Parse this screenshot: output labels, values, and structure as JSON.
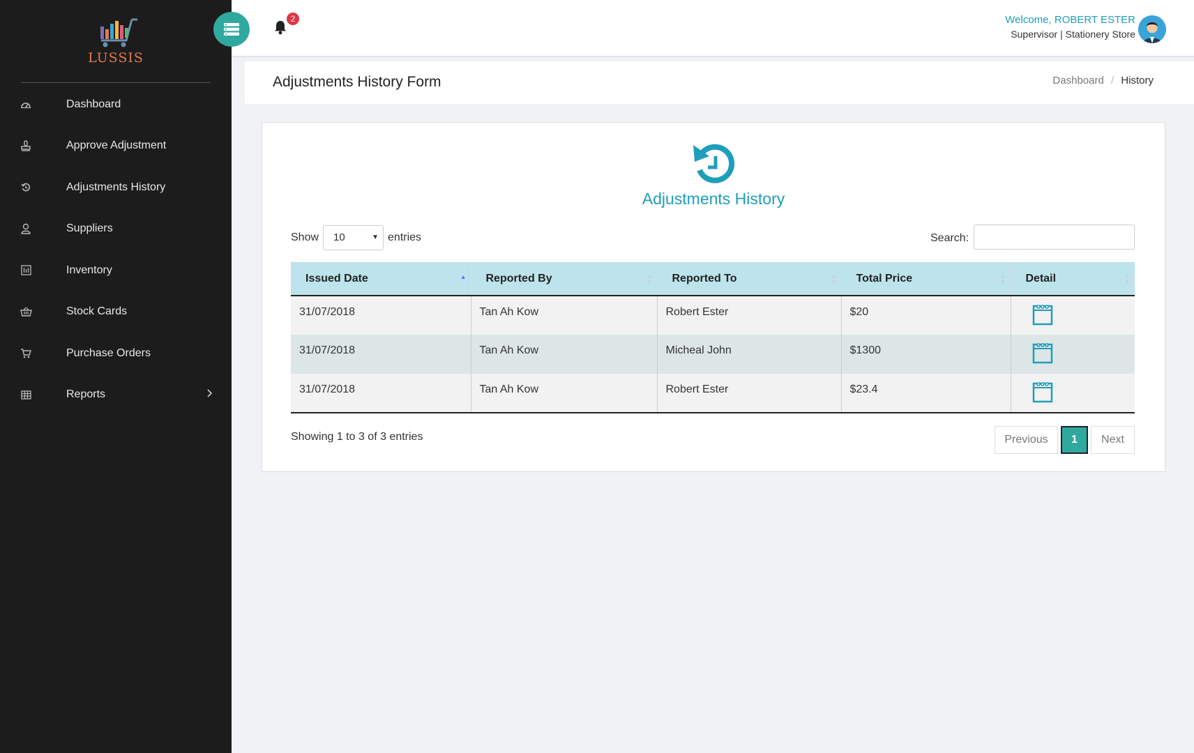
{
  "app": {
    "logo_text": "LUSSIS",
    "notification_count": "2"
  },
  "sidebar": {
    "items": [
      {
        "label": "Dashboard",
        "icon": "dashboard-icon"
      },
      {
        "label": "Approve Adjustment",
        "icon": "stamp-icon"
      },
      {
        "label": "Adjustments History",
        "icon": "history-icon"
      },
      {
        "label": "Suppliers",
        "icon": "user-icon"
      },
      {
        "label": "Inventory",
        "icon": "inventory-icon"
      },
      {
        "label": "Stock Cards",
        "icon": "basket-icon"
      },
      {
        "label": "Purchase Orders",
        "icon": "cart-icon"
      },
      {
        "label": "Reports",
        "icon": "grid-icon"
      }
    ]
  },
  "header": {
    "welcome": "Welcome, ROBERT ESTER",
    "role": "Supervisor | Stationery Store"
  },
  "page": {
    "title": "Adjustments History Form",
    "breadcrumb": {
      "home": "Dashboard",
      "separator": "/",
      "current": "History"
    }
  },
  "card": {
    "title": "Adjustments History",
    "show_label": "Show",
    "entries_label": "entries",
    "page_length": "10",
    "search_label": "Search:",
    "search_value": "",
    "columns": [
      "Issued Date",
      "Reported By",
      "Reported To",
      "Total Price",
      "Detail"
    ],
    "rows": [
      {
        "issued_date": "31/07/2018",
        "reported_by": "Tan Ah Kow",
        "reported_to": "Robert Ester",
        "total_price": "$20"
      },
      {
        "issued_date": "31/07/2018",
        "reported_by": "Tan Ah Kow",
        "reported_to": "Micheal John",
        "total_price": "$1300"
      },
      {
        "issued_date": "31/07/2018",
        "reported_by": "Tan Ah Kow",
        "reported_to": "Robert Ester",
        "total_price": "$23.4"
      }
    ],
    "info": "Showing 1 to 3 of 3 entries",
    "pagination": {
      "previous": "Previous",
      "current": "1",
      "next": "Next"
    }
  },
  "colors": {
    "accent": "#2fa9a0",
    "brand_blue": "#1e9eba",
    "sidebar_bg": "#1c1c1c",
    "table_header": "#bde3ec"
  }
}
